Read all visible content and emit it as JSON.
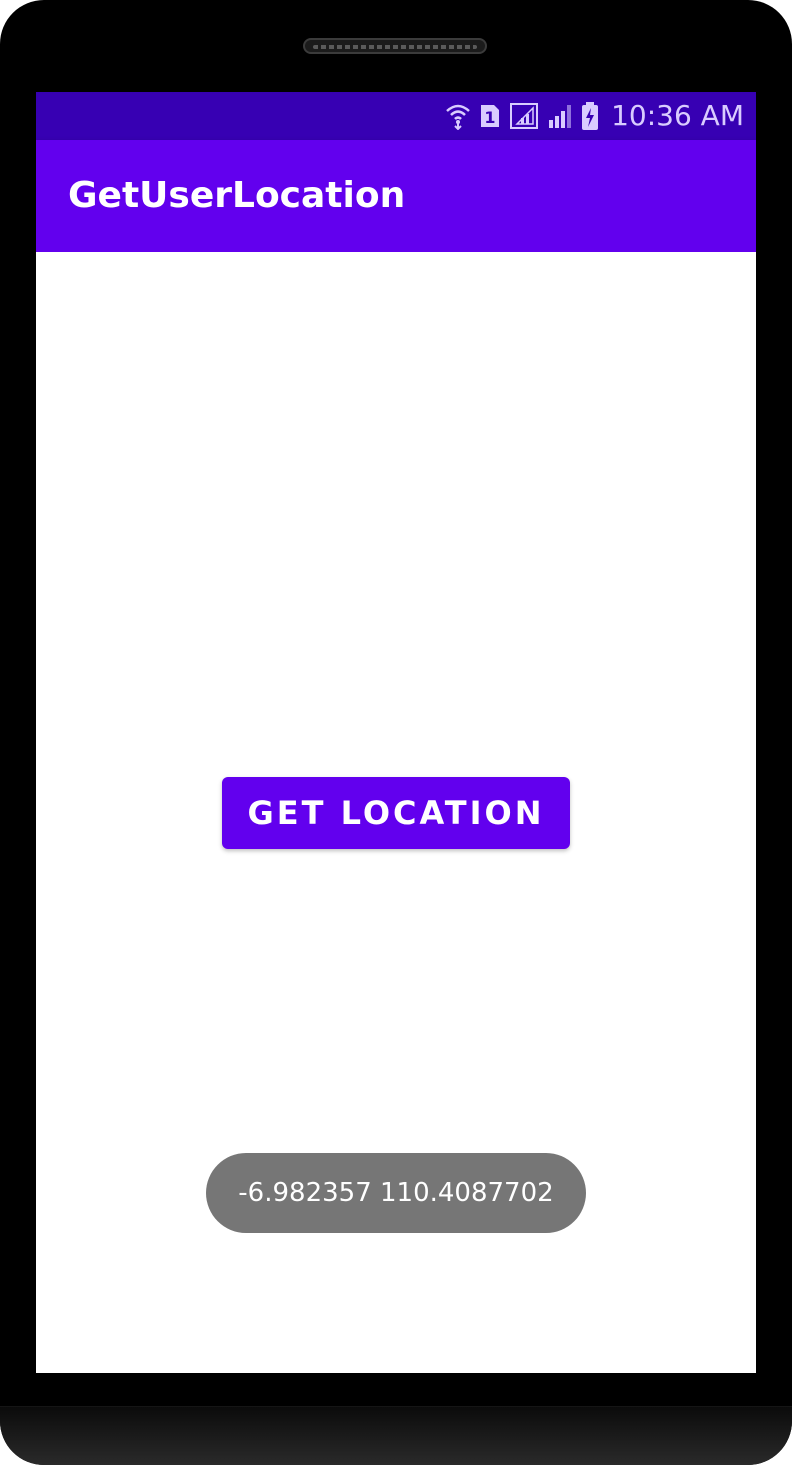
{
  "device": {
    "frame_color": "#000000"
  },
  "status_bar": {
    "time": "10:36 AM",
    "sim_label": "1",
    "icons": [
      "wifi-icon",
      "sim-icon",
      "signal-icon",
      "signal-icon",
      "battery-charging-icon"
    ],
    "background": "#3700B3"
  },
  "app_bar": {
    "title": "GetUserLocation",
    "background": "#6200EE"
  },
  "main": {
    "button_label": "GET LOCATION",
    "button_color": "#6200EE"
  },
  "toast": {
    "text": "-6.982357 110.4087702",
    "background": "#767676"
  }
}
